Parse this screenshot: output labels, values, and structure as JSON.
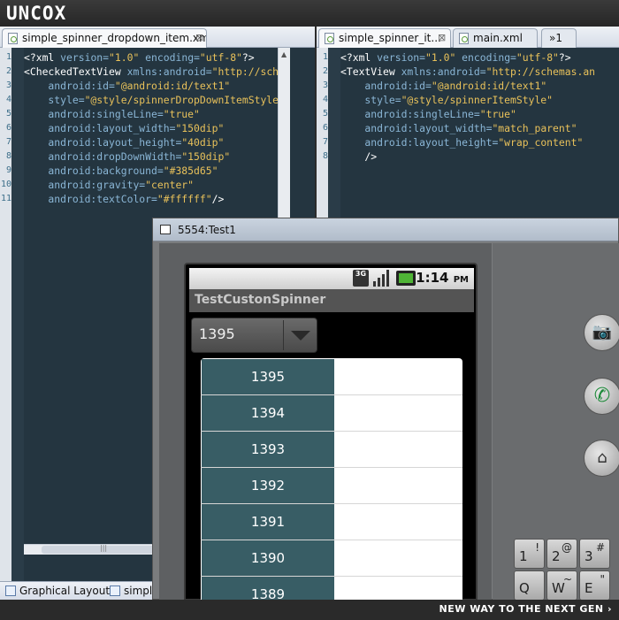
{
  "brand": {
    "logo": "UNCOX",
    "slogan": "NEW WAY TO THE NEXT GEN ›"
  },
  "left_editor": {
    "tab_label": "simple_spinner_dropdown_item.xml",
    "line_numbers": [
      "1",
      "2",
      "3",
      "4",
      "5",
      "6",
      "7",
      "8",
      "9",
      "10",
      "11"
    ],
    "lines": [
      [
        [
          "pi",
          "<?xml "
        ],
        [
          "attr",
          "version="
        ],
        [
          "val",
          "\"1.0\""
        ],
        [
          "attr",
          " encoding="
        ],
        [
          "val",
          "\"utf-8\""
        ],
        [
          "pi",
          "?>"
        ]
      ],
      [
        [
          "tag",
          "<CheckedTextView "
        ],
        [
          "attr",
          "xmlns:android="
        ],
        [
          "val",
          "\"http://sch"
        ]
      ],
      [
        [
          "attr",
          "    android:id="
        ],
        [
          "val",
          "\"@android:id/text1\""
        ]
      ],
      [
        [
          "attr",
          "    style="
        ],
        [
          "val",
          "\"@style/spinnerDropDownItemStyle"
        ]
      ],
      [
        [
          "attr",
          "    android:singleLine="
        ],
        [
          "val",
          "\"true\""
        ]
      ],
      [
        [
          "attr",
          "    android:layout_width="
        ],
        [
          "val",
          "\"150dip\""
        ]
      ],
      [
        [
          "attr",
          "    android:layout_height="
        ],
        [
          "val",
          "\"40dip\""
        ]
      ],
      [
        [
          "attr",
          "    android:dropDownWidth="
        ],
        [
          "val",
          "\"150dip\""
        ]
      ],
      [
        [
          "attr",
          "    android:background="
        ],
        [
          "val",
          "\"#385d65\""
        ]
      ],
      [
        [
          "attr",
          "    android:gravity="
        ],
        [
          "val",
          "\"center\""
        ]
      ],
      [
        [
          "attr",
          "    android:textColor="
        ],
        [
          "val",
          "\"#ffffff\""
        ],
        [
          "tag",
          "/>"
        ]
      ]
    ],
    "bottom_tabs": [
      "Graphical Layout",
      "simpl"
    ]
  },
  "right_editor": {
    "tabs": [
      "simple_spinner_it...",
      "main.xml",
      "»1"
    ],
    "line_numbers": [
      "1",
      "2",
      "3",
      "4",
      "5",
      "6",
      "7",
      "8"
    ],
    "lines": [
      [
        [
          "pi",
          "<?xml "
        ],
        [
          "attr",
          "version="
        ],
        [
          "val",
          "\"1.0\""
        ],
        [
          "attr",
          " encoding="
        ],
        [
          "val",
          "\"utf-8\""
        ],
        [
          "pi",
          "?>"
        ]
      ],
      [
        [
          "tag",
          "<TextView "
        ],
        [
          "attr",
          "xmlns:android="
        ],
        [
          "val",
          "\"http://schemas.an"
        ]
      ],
      [
        [
          "attr",
          "    android:id="
        ],
        [
          "val",
          "\"@android:id/text1\""
        ]
      ],
      [
        [
          "attr",
          "    style="
        ],
        [
          "val",
          "\"@style/spinnerItemStyle\""
        ]
      ],
      [
        [
          "attr",
          "    android:singleLine="
        ],
        [
          "val",
          "\"true\""
        ]
      ],
      [
        [
          "attr",
          "    android:layout_width="
        ],
        [
          "val",
          "\"match_parent\""
        ]
      ],
      [
        [
          "attr",
          "    android:layout_height="
        ],
        [
          "val",
          "\"wrap_content\""
        ]
      ],
      [
        [
          "tag",
          "    />"
        ]
      ]
    ]
  },
  "emulator": {
    "window_title": "5554:Test1",
    "status": {
      "network": "3G",
      "time": "1:14",
      "ampm": "PM"
    },
    "app_title": "TestCustonSpinner",
    "spinner_value": "1395",
    "dropdown_items": [
      "1395",
      "1394",
      "1393",
      "1392",
      "1391",
      "1390",
      "1389"
    ],
    "item_color": "#385d65",
    "keys": [
      {
        "main": "1",
        "sup": "!"
      },
      {
        "main": "2",
        "sup": "@"
      },
      {
        "main": "3",
        "sup": "#"
      },
      {
        "main": "Q",
        "sup": ""
      },
      {
        "main": "W",
        "sup": "~"
      },
      {
        "main": "E",
        "sup": "\""
      }
    ]
  }
}
